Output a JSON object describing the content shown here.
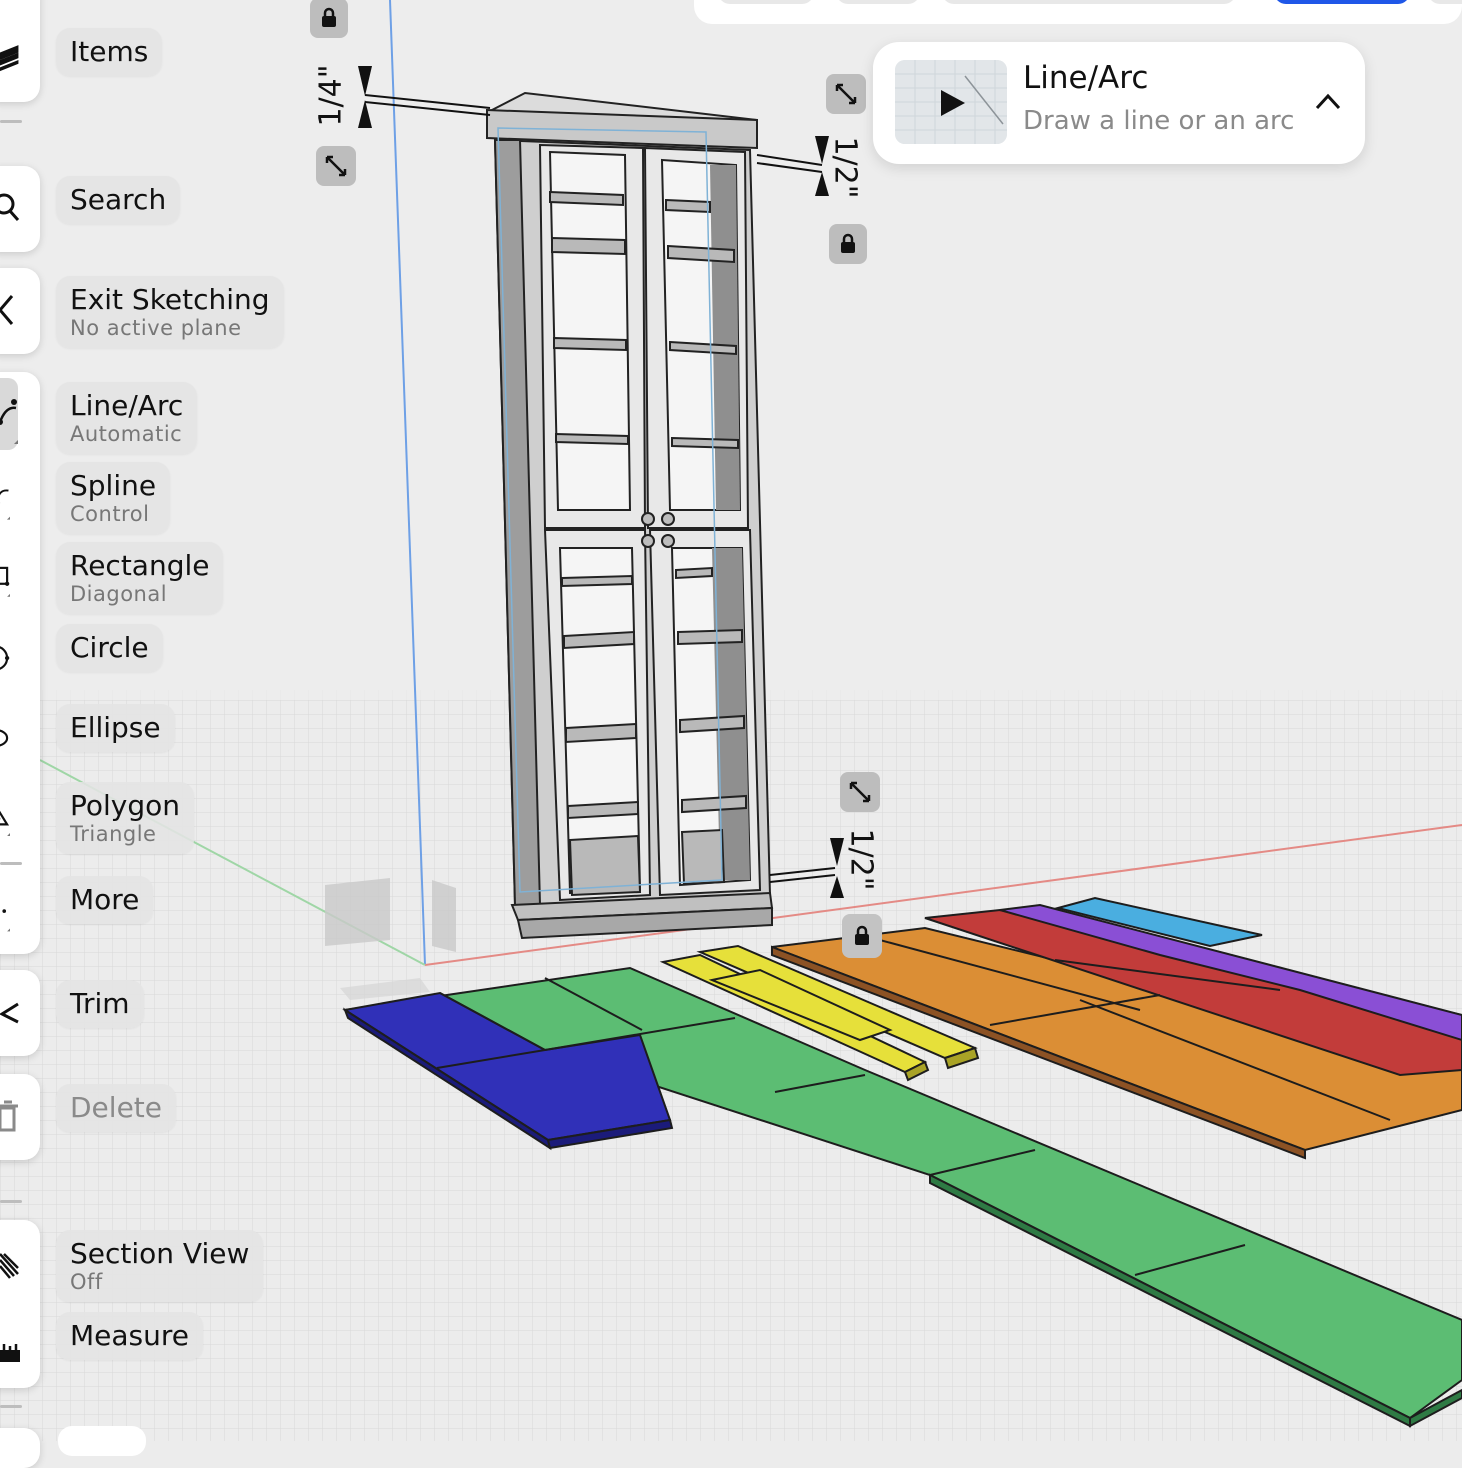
{
  "toolbar": {
    "items": [
      {
        "id": "items",
        "label": "Items",
        "sub": ""
      },
      {
        "id": "search",
        "label": "Search",
        "sub": ""
      },
      {
        "id": "exit-sketching",
        "label": "Exit Sketching",
        "sub": "No active plane"
      },
      {
        "id": "line-arc",
        "label": "Line/Arc",
        "sub": "Automatic"
      },
      {
        "id": "spline",
        "label": "Spline",
        "sub": "Control"
      },
      {
        "id": "rectangle",
        "label": "Rectangle",
        "sub": "Diagonal"
      },
      {
        "id": "circle",
        "label": "Circle",
        "sub": ""
      },
      {
        "id": "ellipse",
        "label": "Ellipse",
        "sub": ""
      },
      {
        "id": "polygon",
        "label": "Polygon",
        "sub": "Triangle"
      },
      {
        "id": "more",
        "label": "More",
        "sub": ""
      },
      {
        "id": "trim",
        "label": "Trim",
        "sub": ""
      },
      {
        "id": "delete",
        "label": "Delete",
        "sub": ""
      },
      {
        "id": "section-view",
        "label": "Section View",
        "sub": "Off"
      },
      {
        "id": "measure",
        "label": "Measure",
        "sub": ""
      }
    ]
  },
  "help_card": {
    "title": "Line/Arc",
    "subtitle": "Draw a line or an arc"
  },
  "dimensions": {
    "top_left": "1/4\"",
    "top_right": "1/2\"",
    "bottom_right": "1/2\""
  },
  "colors": {
    "accent": "#1f57e8",
    "board_blue": "#2f2fb5",
    "board_green": "#55b96e",
    "board_yellow": "#e8e23a",
    "board_orange": "#dc8f36",
    "board_red": "#c23d3a",
    "board_purple": "#8b4fd6",
    "board_lightblue": "#4aaee0",
    "cabinet": "#cfd0cf"
  },
  "icons": {
    "items": "layers-icon",
    "search": "magnifier-icon",
    "exit": "chevron-left-icon",
    "line": "line-arc-icon",
    "spline": "spline-icon",
    "rect": "rectangle-icon",
    "circle": "circle-icon",
    "ellipse": "ellipse-icon",
    "polygon": "triangle-icon",
    "more": "ellipsis-icon",
    "trim": "scissors-icon",
    "delete": "trash-icon",
    "section": "section-hatch-icon",
    "measure": "ruler-icon"
  }
}
